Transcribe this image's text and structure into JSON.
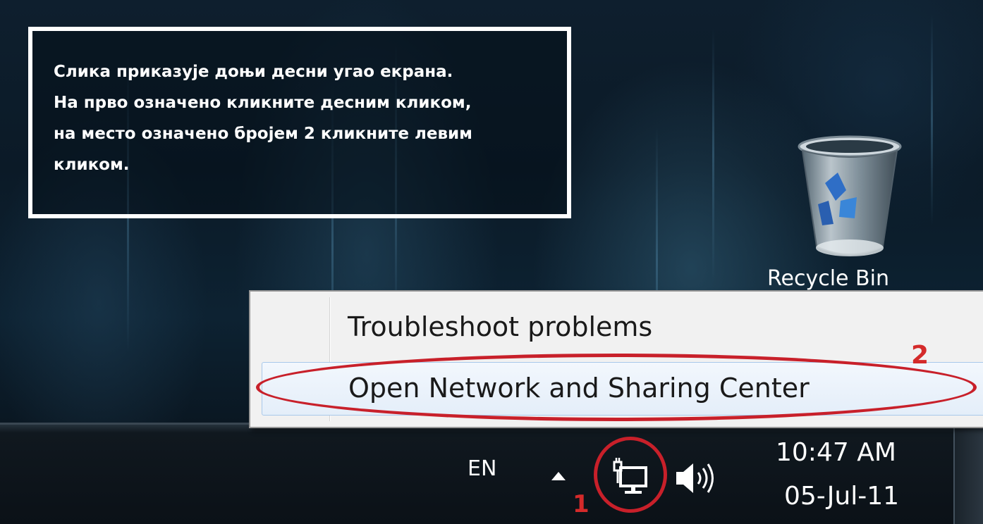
{
  "instruction": {
    "line1": "Слика приказује доњи десни угао екрана.",
    "line2": "На прво означено кликните десним кликом,",
    "line3": "на место означено бројем 2 кликните левим",
    "line4": "кликом."
  },
  "desktop": {
    "recycle_bin_label": "Recycle Bin"
  },
  "context_menu": {
    "items": [
      {
        "label": "Troubleshoot problems"
      },
      {
        "label": "Open Network and Sharing Center"
      }
    ]
  },
  "taskbar": {
    "language": "EN",
    "clock_time": "10:47 AM",
    "clock_date": "05-Jul-11",
    "icons": [
      "show-hidden-icons-arrow",
      "network-icon",
      "volume-icon"
    ]
  },
  "annotations": {
    "marker_1": "1",
    "marker_2": "2",
    "highlight_color": "#c8202a"
  }
}
